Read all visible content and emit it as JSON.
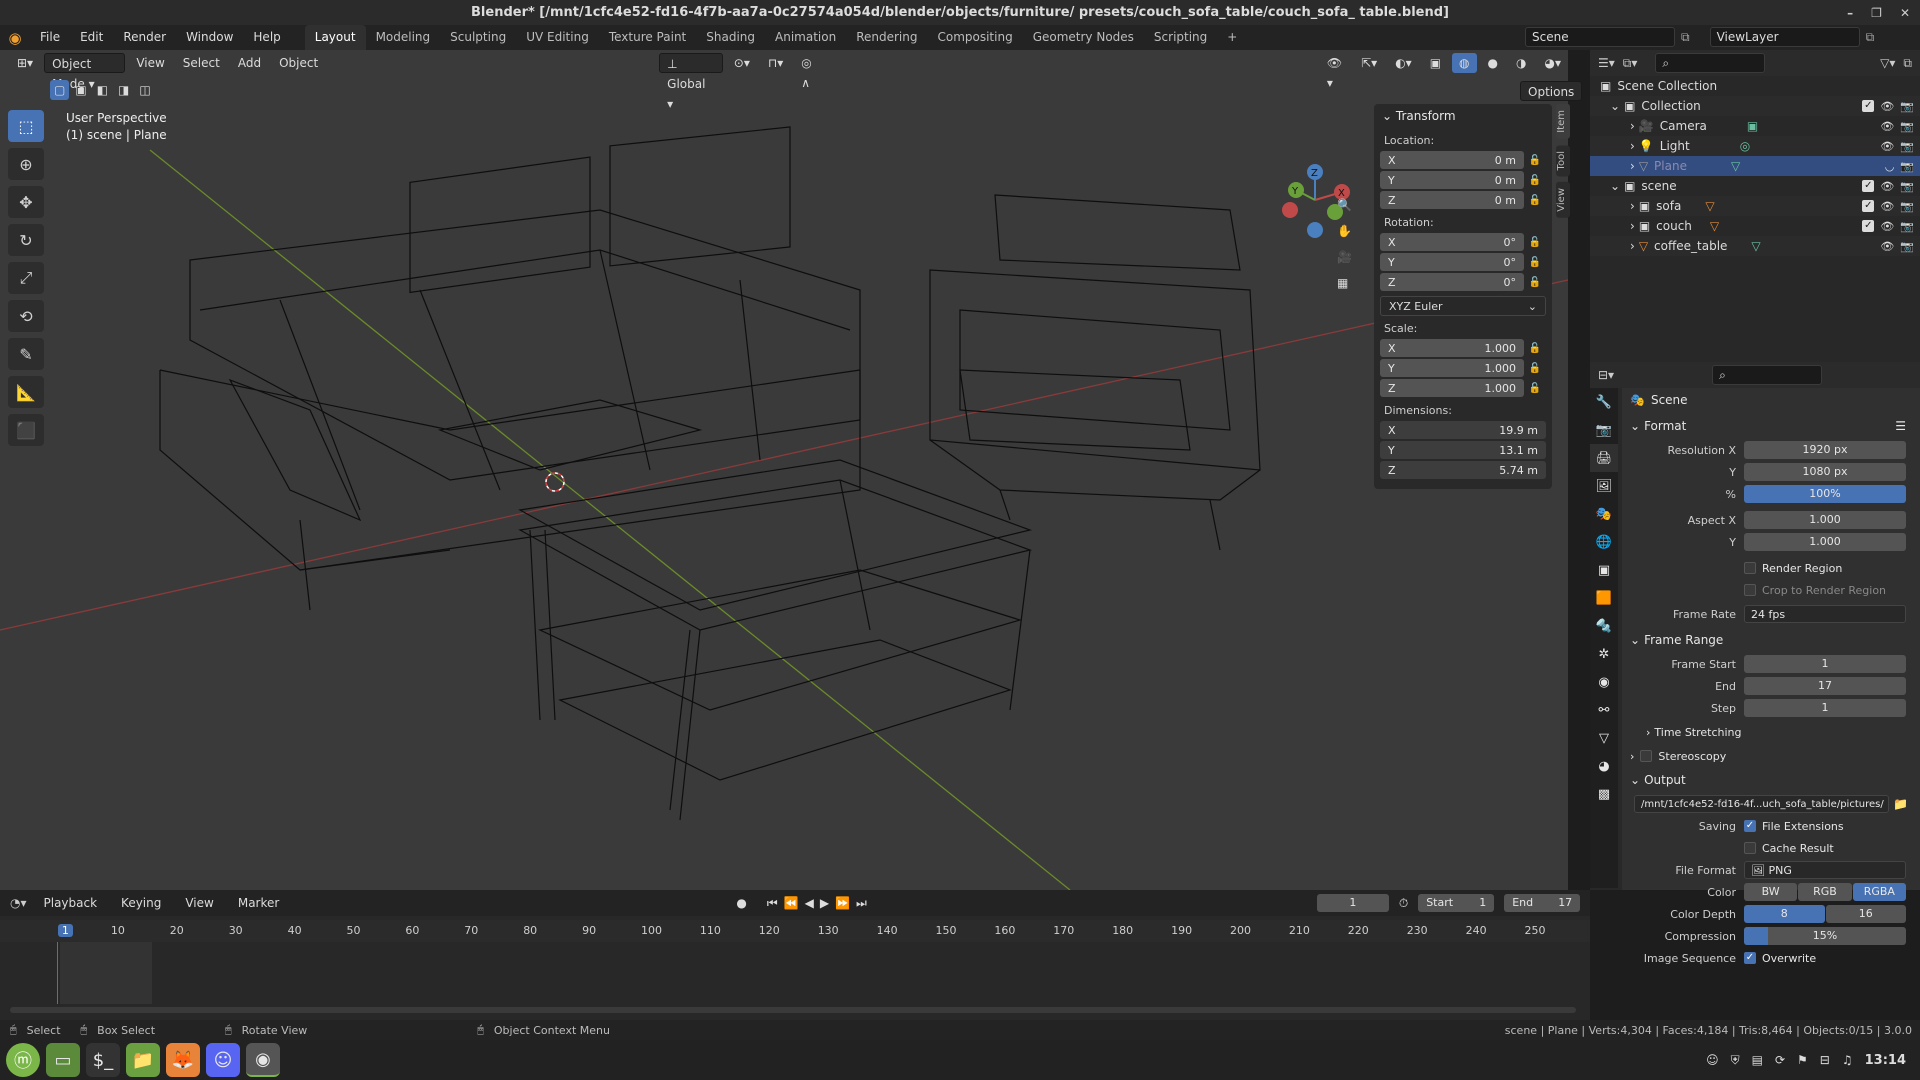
{
  "window": {
    "title": "Blender* [/mnt/1cfc4e52-fd16-4f7b-aa7a-0c27574a054d/blender/objects/furniture/ presets/couch_sofa_table/couch_sofa_ table.blend]"
  },
  "menu": [
    "File",
    "Edit",
    "Render",
    "Window",
    "Help"
  ],
  "workspaces": [
    "Layout",
    "Modeling",
    "Sculpting",
    "UV Editing",
    "Texture Paint",
    "Shading",
    "Animation",
    "Rendering",
    "Compositing",
    "Geometry Nodes",
    "Scripting"
  ],
  "scene_name": "Scene",
  "view_layer": "ViewLayer",
  "viewport": {
    "mode": "Object Mode",
    "menus": [
      "View",
      "Select",
      "Add",
      "Object"
    ],
    "transform_orientation": "Global",
    "options_label": "Options",
    "overlay_line1": "User Perspective",
    "overlay_line2": "(1) scene | Plane",
    "accent": "#4772b3"
  },
  "npanel": {
    "title": "Transform",
    "location_label": "Location:",
    "location": [
      {
        "axis": "X",
        "value": "0 m"
      },
      {
        "axis": "Y",
        "value": "0 m"
      },
      {
        "axis": "Z",
        "value": "0 m"
      }
    ],
    "rotation_label": "Rotation:",
    "rotation": [
      {
        "axis": "X",
        "value": "0°"
      },
      {
        "axis": "Y",
        "value": "0°"
      },
      {
        "axis": "Z",
        "value": "0°"
      }
    ],
    "rotation_mode": "XYZ Euler",
    "scale_label": "Scale:",
    "scale": [
      {
        "axis": "X",
        "value": "1.000"
      },
      {
        "axis": "Y",
        "value": "1.000"
      },
      {
        "axis": "Z",
        "value": "1.000"
      }
    ],
    "dimensions_label": "Dimensions:",
    "dimensions": [
      {
        "axis": "X",
        "value": "19.9 m"
      },
      {
        "axis": "Y",
        "value": "13.1 m"
      },
      {
        "axis": "Z",
        "value": "5.74 m"
      }
    ],
    "tabs": [
      "Item",
      "Tool",
      "View"
    ]
  },
  "outliner": {
    "root": "Scene Collection",
    "items": [
      {
        "label": "Collection",
        "level": 1,
        "selected": false
      },
      {
        "label": "Camera",
        "level": 2,
        "selected": false
      },
      {
        "label": "Light",
        "level": 2,
        "selected": false
      },
      {
        "label": "Plane",
        "level": 2,
        "selected": true
      },
      {
        "label": "scene",
        "level": 1,
        "selected": false
      },
      {
        "label": "sofa",
        "level": 2,
        "selected": false
      },
      {
        "label": "couch",
        "level": 2,
        "selected": false
      },
      {
        "label": "coffee_table",
        "level": 2,
        "selected": false
      }
    ]
  },
  "properties": {
    "context": "Scene",
    "format_title": "Format",
    "res_x_label": "Resolution X",
    "res_x": "1920 px",
    "res_y_label": "Y",
    "res_y": "1080 px",
    "res_pct_label": "%",
    "res_pct": "100%",
    "aspect_x_label": "Aspect X",
    "aspect_x": "1.000",
    "aspect_y_label": "Y",
    "aspect_y": "1.000",
    "render_region": "Render Region",
    "crop_region": "Crop to Render Region",
    "frame_rate_label": "Frame Rate",
    "frame_rate": "24 fps",
    "frame_range_title": "Frame Range",
    "frame_start_label": "Frame Start",
    "frame_start": "1",
    "end_label": "End",
    "end": "17",
    "step_label": "Step",
    "step": "1",
    "time_stretching": "Time Stretching",
    "stereoscopy": "Stereoscopy",
    "output_title": "Output",
    "output_path": "/mnt/1cfc4e52-fd16-4f...uch_sofa_table/pictures/",
    "saving_label": "Saving",
    "file_extensions": "File Extensions",
    "cache_result": "Cache Result",
    "file_format_label": "File Format",
    "file_format": "PNG",
    "color_label": "Color",
    "color_opts": [
      "BW",
      "RGB",
      "RGBA"
    ],
    "color_depth_label": "Color Depth",
    "color_depth_opts": [
      "8",
      "16"
    ],
    "compression_label": "Compression",
    "compression": "15%",
    "compression_fraction": 0.15,
    "image_sequence_label": "Image Sequence",
    "overwrite": "Overwrite"
  },
  "timeline": {
    "menus": [
      "Playback",
      "Keying",
      "View",
      "Marker"
    ],
    "current_frame": "1",
    "start_label": "Start",
    "start": "1",
    "end_label": "End",
    "end": "17",
    "ticks": [
      "1",
      "10",
      "20",
      "30",
      "40",
      "50",
      "60",
      "70",
      "80",
      "90",
      "100",
      "110",
      "120",
      "130",
      "140",
      "150",
      "160",
      "170",
      "180",
      "190",
      "200",
      "210",
      "220",
      "230",
      "240",
      "250"
    ]
  },
  "statusbar": {
    "select": "Select",
    "box_select": "Box Select",
    "rotate_view": "Rotate View",
    "context_menu": "Object Context Menu",
    "stats": "scene | Plane | Verts:4,304 | Faces:4,184 | Tris:8,464 | Objects:0/15 | 3.0.0"
  },
  "taskbar": {
    "clock": "13:14"
  }
}
